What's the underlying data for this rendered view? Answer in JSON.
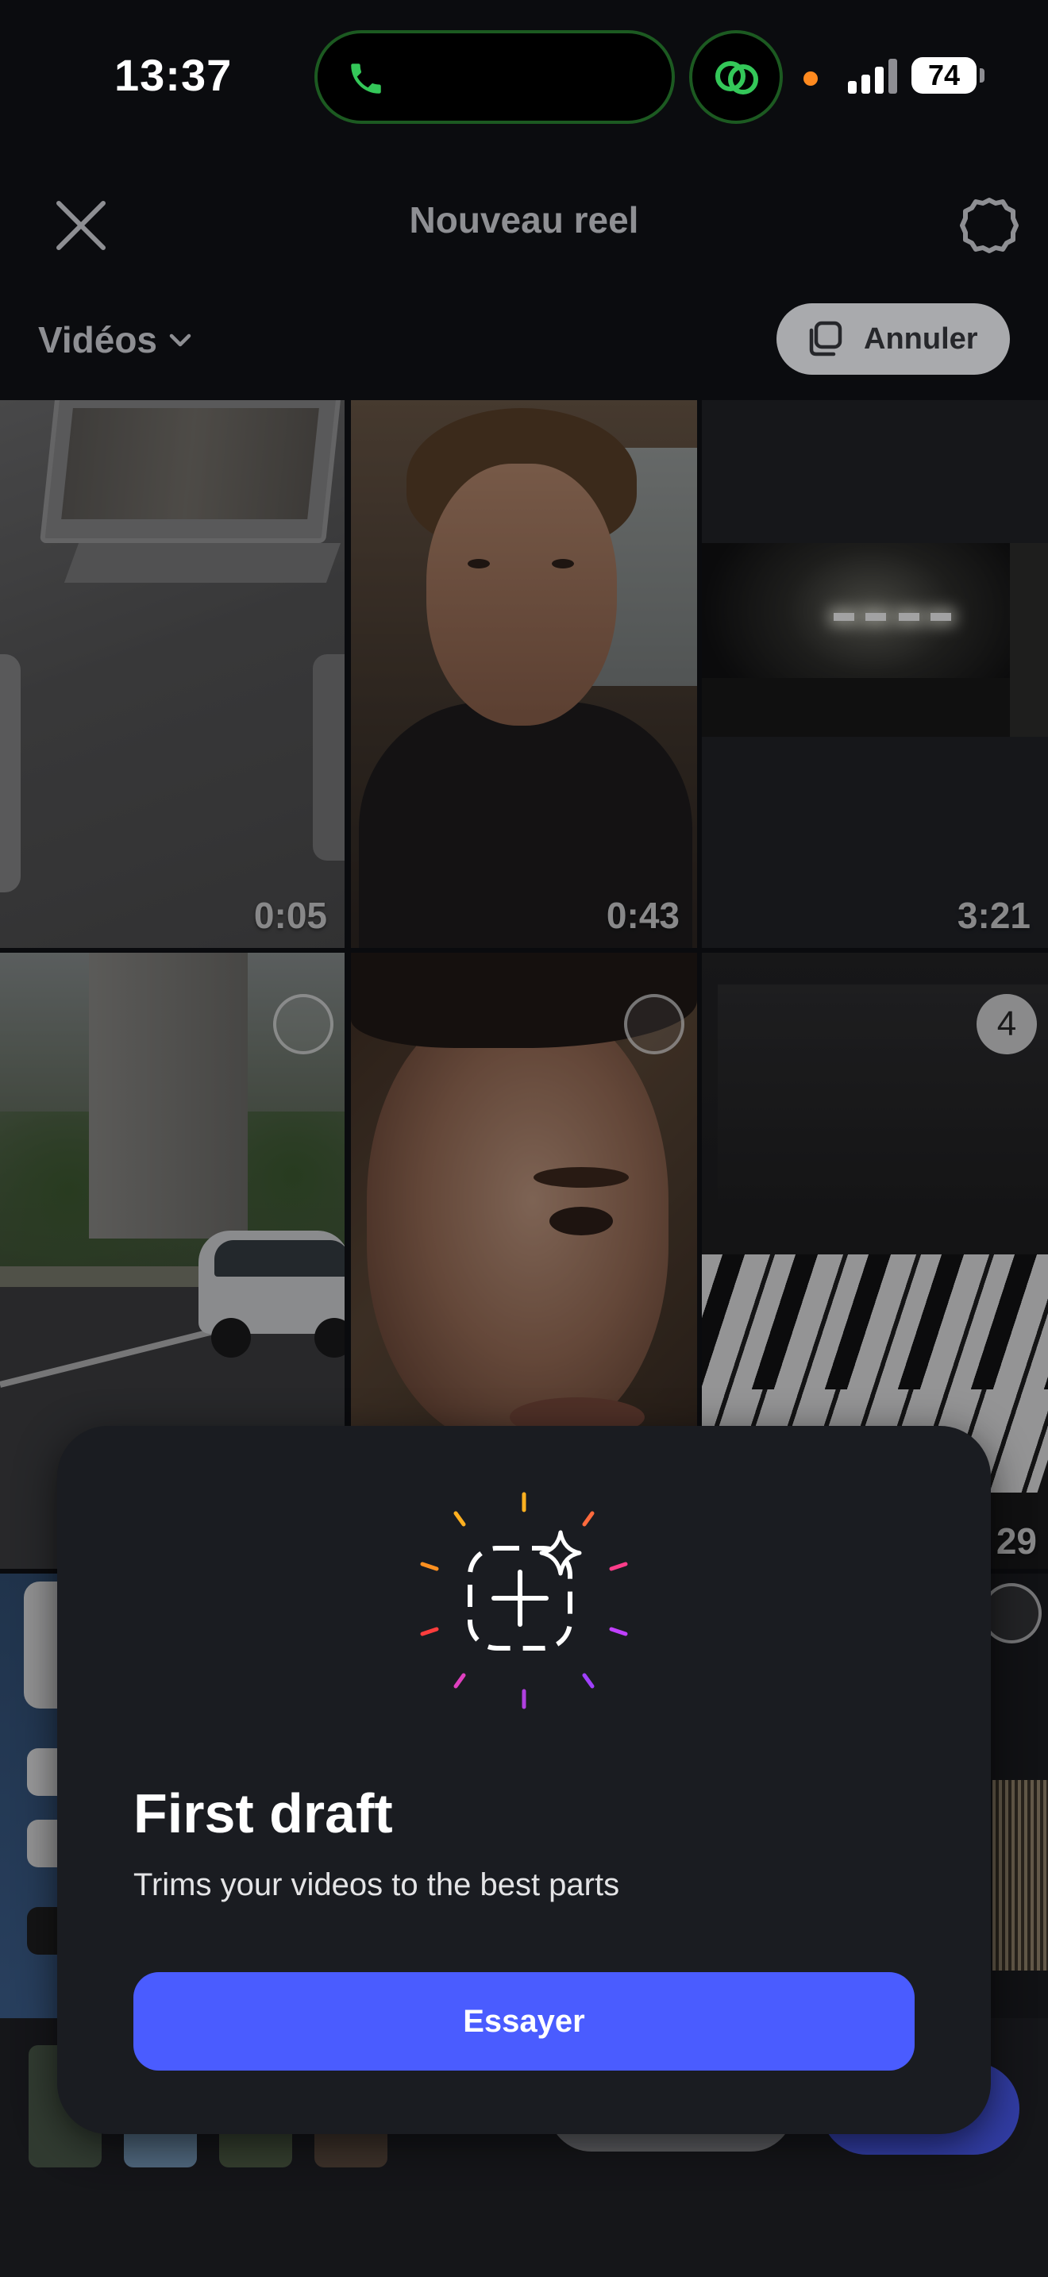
{
  "status_bar": {
    "time": "13:37",
    "battery": "74"
  },
  "header": {
    "title": "Nouveau reel"
  },
  "filter": {
    "label": "Vidéos"
  },
  "cancel_button": {
    "label": "Annuler"
  },
  "grid": {
    "tiles": [
      {
        "duration": "0:05"
      },
      {
        "duration": "0:43"
      },
      {
        "duration": "3:21"
      },
      {
        "selected_index": "4",
        "duration_partial": "29"
      }
    ]
  },
  "sheet": {
    "title": "First draft",
    "subtitle": "Trims your videos to the best parts",
    "button_label": "Essayer"
  },
  "colors": {
    "accent_blue": "#4a5cff",
    "call_green": "#34c759",
    "mic_dot": "#ff8a1f"
  },
  "icons": [
    "phone-call-icon",
    "linked-circles-icon",
    "close-icon",
    "settings-gear-icon",
    "chevron-down-icon",
    "multi-select-icon",
    "sparkle-add-icon"
  ]
}
